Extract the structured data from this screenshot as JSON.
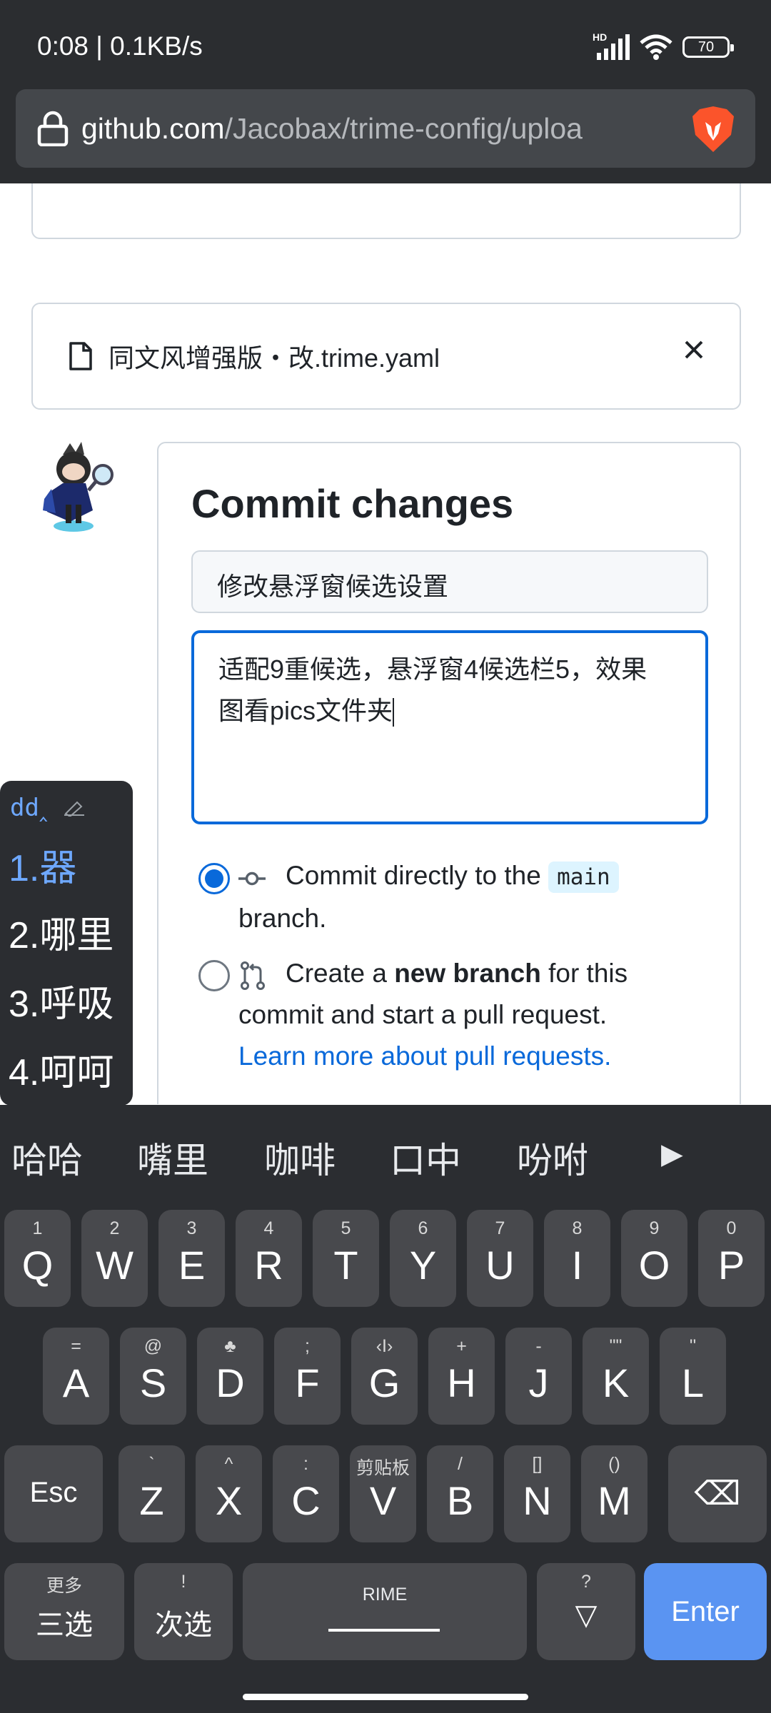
{
  "status": {
    "time": "0:08 | 0.1KB/s",
    "battery": "70",
    "network": "HD"
  },
  "browser": {
    "url_host": "github.com",
    "url_path": "/Jacobax/trime-config/uploa"
  },
  "file": {
    "name": "同文风增强版・改.trime.yaml"
  },
  "commit": {
    "title": "Commit changes",
    "summary": "修改悬浮窗候选设置",
    "description_line1": "适配9重候选，悬浮窗4候选栏5，效果",
    "description_line2": "图看pics文件夹",
    "option_direct_pre": "Commit directly to the",
    "option_direct_branch": "main",
    "option_direct_post": "branch.",
    "option_new_pre": "Create a",
    "option_new_bold": "new branch",
    "option_new_post": "for this",
    "option_new_line2": "commit and start a pull request.",
    "learn_more": "Learn more about pull requests."
  },
  "ime": {
    "preedit": "dd‸",
    "candidates": [
      "1.器",
      "2.哪里",
      "3.呼吸",
      "4.呵呵"
    ]
  },
  "suggestions": [
    "哈哈",
    "嘴里",
    "咖啡",
    "口中",
    "吩咐",
    "▶"
  ],
  "keyboard": {
    "row1": [
      {
        "k": "Q",
        "h": "1"
      },
      {
        "k": "W",
        "h": "2"
      },
      {
        "k": "E",
        "h": "3"
      },
      {
        "k": "R",
        "h": "4"
      },
      {
        "k": "T",
        "h": "5"
      },
      {
        "k": "Y",
        "h": "6"
      },
      {
        "k": "U",
        "h": "7"
      },
      {
        "k": "I",
        "h": "8"
      },
      {
        "k": "O",
        "h": "9"
      },
      {
        "k": "P",
        "h": "0"
      }
    ],
    "row2": [
      {
        "k": "A",
        "h": "="
      },
      {
        "k": "S",
        "h": "@"
      },
      {
        "k": "D",
        "h": "♣"
      },
      {
        "k": "F",
        "h": ";"
      },
      {
        "k": "G",
        "h": "‹I›"
      },
      {
        "k": "H",
        "h": "+"
      },
      {
        "k": "J",
        "h": "-"
      },
      {
        "k": "K",
        "h": "\"\""
      },
      {
        "k": "L",
        "h": "''"
      }
    ],
    "row3": [
      {
        "k": "Z",
        "h": "`"
      },
      {
        "k": "X",
        "h": "^"
      },
      {
        "k": "C",
        "h": ":"
      },
      {
        "k": "V",
        "h": "剪贴板"
      },
      {
        "k": "B",
        "h": "/"
      },
      {
        "k": "N",
        "h": "[]"
      },
      {
        "k": "M",
        "h": "()"
      }
    ],
    "esc": "Esc",
    "backspace": "⌫",
    "more_hint": "更多",
    "third": "三选",
    "second_hint": "!",
    "second": "次选",
    "space": "RIME",
    "question_hint": "?",
    "question": "▽",
    "enter": "Enter"
  },
  "colors": {
    "accent": "#0969da",
    "enter": "#5a94f2",
    "dark": "#2b2d31",
    "key": "#48494d"
  }
}
